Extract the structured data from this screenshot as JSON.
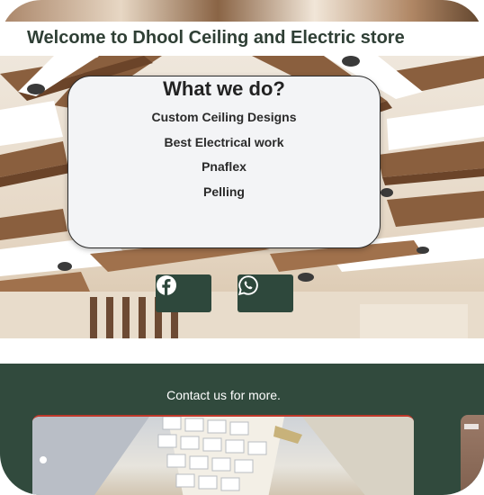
{
  "header": {
    "title": "Welcome to Dhool Ceiling and Electric store"
  },
  "services_card": {
    "title": "What we do?",
    "items": [
      "Custom Ceiling Designs",
      "Best Electrical work",
      "Pnaflex",
      "Pelling"
    ]
  },
  "social": {
    "facebook": {
      "icon": "facebook-icon"
    },
    "whatsapp": {
      "icon": "whatsapp-icon"
    }
  },
  "contact": {
    "text": "Contact us for more."
  },
  "colors": {
    "accent": "#2e483c",
    "contact_bg": "#314a3d",
    "title": "#2f3f35"
  }
}
